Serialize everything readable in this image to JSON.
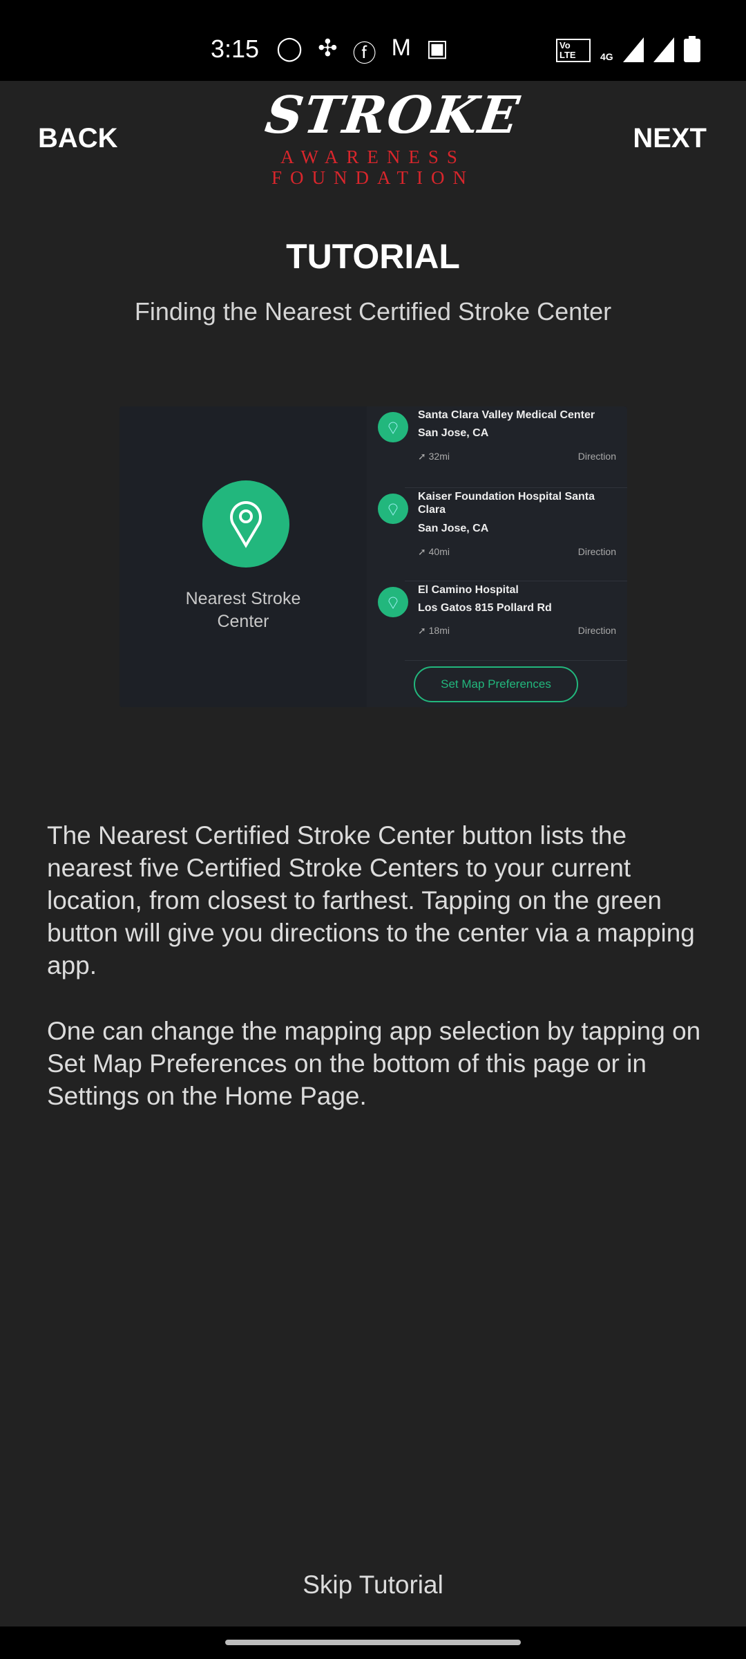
{
  "status_bar": {
    "time": "3:15",
    "icons": [
      "whatsapp-icon",
      "slack-icon",
      "facebook-icon",
      "gmail-icon",
      "gallery-icon"
    ],
    "right_icons": [
      "volte-icon",
      "4g-icon",
      "signal-icon",
      "signal-icon",
      "battery-icon"
    ],
    "network": "4G",
    "volte": "Vo LTE"
  },
  "header": {
    "back": "BACK",
    "next": "NEXT",
    "logo": {
      "word": "STROKE",
      "line2": "AWARENESS",
      "line3": "FOUNDATION"
    }
  },
  "title": "TUTORIAL",
  "subtitle": "Finding the Nearest Certified Stroke Center",
  "screenshot": {
    "button_label": "Nearest Stroke Center",
    "accent": "#22b77d",
    "items": [
      {
        "name": "Santa Clara Valley Medical Center",
        "address": "San Jose, CA",
        "distance": "32mi",
        "action": "Direction"
      },
      {
        "name": "Kaiser Foundation Hospital Santa Clara",
        "address": "San Jose, CA",
        "distance": "40mi",
        "action": "Direction"
      },
      {
        "name": "El Camino Hospital",
        "address": "Los Gatos 815 Pollard Rd",
        "distance": "18mi",
        "action": "Direction"
      }
    ],
    "map_prefs": "Set Map Preferences"
  },
  "body": {
    "p1": "The Nearest Certified Stroke Center button lists the nearest five Certified Stroke Centers to your current location, from closest to farthest. Tapping on the green button will give you directions to the center via a mapping app.",
    "p2": "One can change the mapping app selection by tapping on Set Map Preferences on the bottom of this page or in Settings on the Home Page."
  },
  "skip": "Skip Tutorial"
}
